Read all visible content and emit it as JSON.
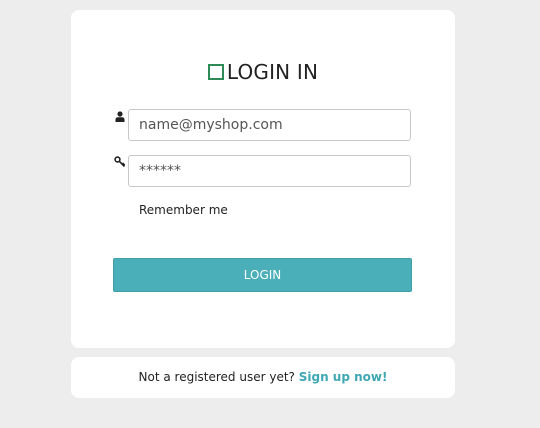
{
  "login_card": {
    "title": "LOGIN IN",
    "email_placeholder": "name@myshop.com",
    "password_value": "******",
    "remember_label": "Remember me",
    "login_button": "LOGIN"
  },
  "footer": {
    "prompt": "Not a registered user yet?",
    "signup_link": "Sign up now!"
  },
  "icons": {
    "brand": "square-logo-icon",
    "email": "user-icon",
    "password": "key-icon"
  },
  "colors": {
    "background": "#ededed",
    "card": "#ffffff",
    "accent": "#4aafb9",
    "link": "#3fa7b3",
    "brand": "#2e8b57"
  }
}
